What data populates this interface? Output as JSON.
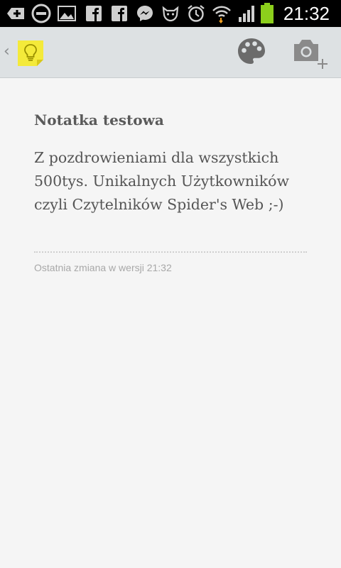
{
  "status_bar": {
    "time": "21:32",
    "icons": [
      "add-icon",
      "do-not-disturb-icon",
      "image-icon",
      "facebook-icon",
      "facebook-icon",
      "messenger-icon",
      "cat-icon",
      "alarm-icon",
      "wifi-icon",
      "signal-icon",
      "battery-icon"
    ],
    "battery_color": "#8ccf1c"
  },
  "action_bar": {
    "logo_icon": "lightbulb-note-icon",
    "palette_icon": "palette-icon",
    "camera_icon": "add-photo-icon",
    "background": "#dde1e3"
  },
  "note": {
    "title": "Notatka testowa",
    "body": "Z pozdrowieniami dla wszystkich 500tys. Unikalnych Użytkowników czyli Czytelników Spider's Web ;-)",
    "last_edit": "Ostatnia zmiana w wersji 21:32"
  }
}
